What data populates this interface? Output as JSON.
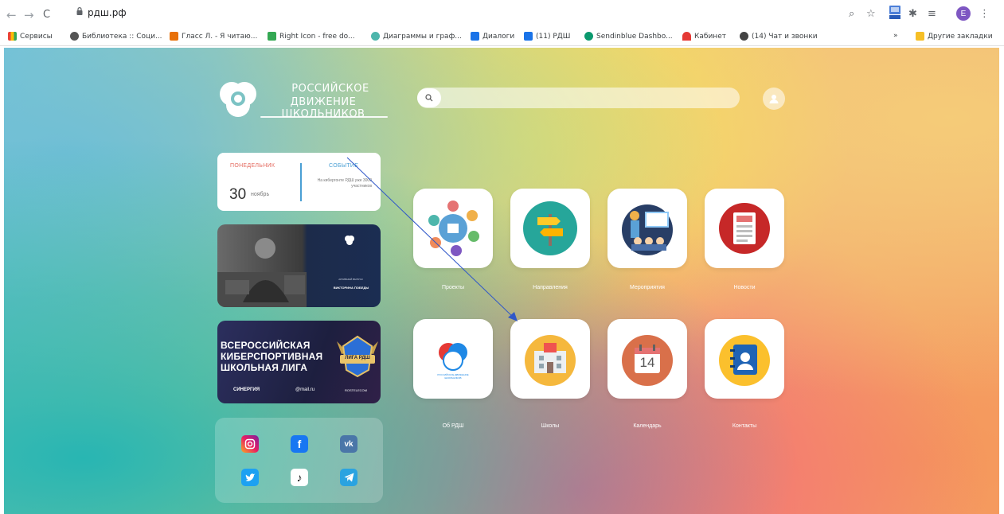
{
  "browser": {
    "back_glyph": "←",
    "forward_glyph": "→",
    "reload_glyph": "C",
    "url": "рдш.рф",
    "profile_initial": "E",
    "bookmarks": [
      {
        "label": "Сервисы",
        "color": "#4285f4"
      },
      {
        "label": "Библиотека :: Соци...",
        "color": "#555555"
      },
      {
        "label": "Гласс Л. - Я читаю...",
        "color": "#e8710a"
      },
      {
        "label": "Right Icon - free do...",
        "color": "#34a853"
      },
      {
        "label": "Диаграммы и граф...",
        "color": "#4db6ac"
      },
      {
        "label": "Диалоги",
        "color": "#1a73e8"
      },
      {
        "label": "(11) РДШ",
        "color": "#1a73e8"
      },
      {
        "label": "Sendinblue Dashbo...",
        "color": "#0b996e"
      },
      {
        "label": "Кабинет",
        "color": "#e53935"
      },
      {
        "label": "(14) Чат и звонки",
        "color": "#444444"
      }
    ],
    "bookmarks_more": "»",
    "other_bookmarks": "Другие закладки"
  },
  "header": {
    "logo_line1": "РОССИЙСКОЕ",
    "logo_line2": "ДВИЖЕНИЕ ШКОЛЬНИКОВ"
  },
  "date_card": {
    "day_label": "ПОНЕДЕЛЬНИК",
    "day_number": "30",
    "month": "ноябрь",
    "event_label": "СОБЫТИЕ",
    "event_text": "На кибергонте РДШ уже 3000 участников"
  },
  "banner1": {
    "caption_small": "АРХИВНЫЙ ВЫПУСК",
    "caption": "ВИКТОРИНА ПОБЕДЫ"
  },
  "banner2": {
    "line1": "ВСЕРОССИЙСКАЯ",
    "line2": "КИБЕРСПОРТИВНАЯ",
    "line3": "ШКОЛЬНАЯ ЛИГА",
    "badge_text": "ЛИГА РДШ",
    "partner1": "СИНЕРГИЯ",
    "partner2": "@mail.ru",
    "partner3": "ROSTELECOM"
  },
  "social": {
    "vk_text": "vk",
    "facebook_text": "f",
    "tiktok_text": "♪"
  },
  "tiles": [
    {
      "label": "Проекты"
    },
    {
      "label": "Направления"
    },
    {
      "label": "Мероприятия"
    },
    {
      "label": "Новости"
    },
    {
      "label": "Об РДШ"
    },
    {
      "label": "Школы"
    },
    {
      "label": "Календарь",
      "date_text": "14"
    },
    {
      "label": "Контакты"
    }
  ],
  "about_logo_text": "РОССИЙСКОЕ ДВИЖЕНИЕ ШКОЛЬНИКОВ",
  "annotation": {
    "arrow_color": "#2f57c9"
  }
}
